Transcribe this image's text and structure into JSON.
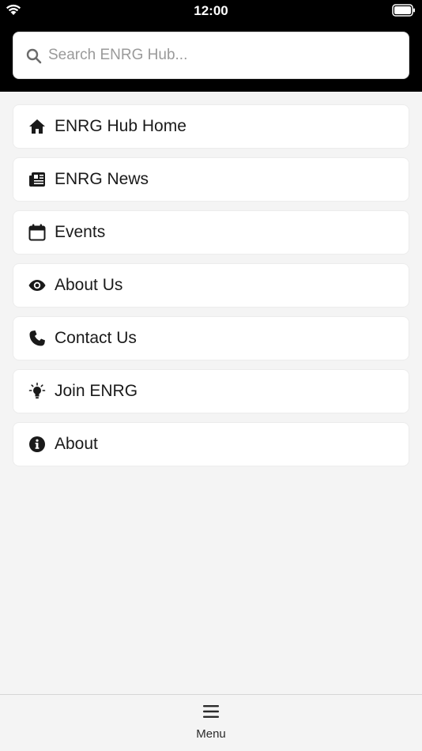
{
  "status": {
    "time": "12:00"
  },
  "search": {
    "placeholder": "Search ENRG Hub...",
    "value": ""
  },
  "menu": {
    "items": [
      {
        "label": "ENRG Hub Home",
        "icon": "home-icon"
      },
      {
        "label": "ENRG News",
        "icon": "newspaper-icon"
      },
      {
        "label": "Events",
        "icon": "calendar-icon"
      },
      {
        "label": "About Us",
        "icon": "eye-icon"
      },
      {
        "label": "Contact Us",
        "icon": "phone-icon"
      },
      {
        "label": "Join ENRG",
        "icon": "lightbulb-icon"
      },
      {
        "label": "About",
        "icon": "info-icon"
      }
    ]
  },
  "tabbar": {
    "menu_label": "Menu",
    "icon": "hamburger-menu-icon"
  },
  "colors": {
    "header": "#000000",
    "background": "#f4f4f4",
    "card": "#ffffff",
    "text": "#1a1a1a"
  }
}
